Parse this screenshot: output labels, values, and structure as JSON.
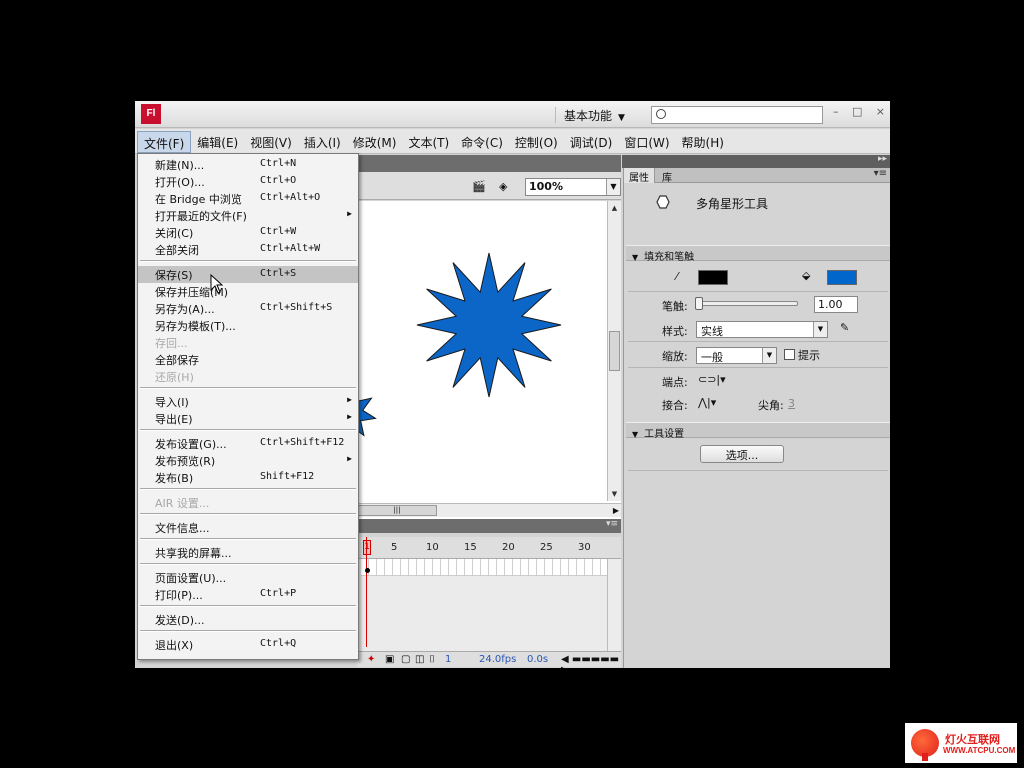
{
  "app": {
    "logo": "Fl",
    "workspace": "基本功能",
    "search_placeholder": "",
    "window_buttons": [
      "–",
      "□",
      "×"
    ]
  },
  "menubar": [
    "文件(F)",
    "编辑(E)",
    "视图(V)",
    "插入(I)",
    "修改(M)",
    "文本(T)",
    "命令(C)",
    "控制(O)",
    "调试(D)",
    "窗口(W)",
    "帮助(H)"
  ],
  "doc_toolbar": {
    "zoom": "100%"
  },
  "timeline": {
    "ticks": [
      "1",
      "5",
      "10",
      "15",
      "20",
      "25",
      "30"
    ],
    "current_frame": "1",
    "fps": "24.0fps",
    "time": "0.0s"
  },
  "properties": {
    "tabs": [
      "属性",
      "库"
    ],
    "tool_name": "多角星形工具",
    "fill_stroke_section": "填充和笔触",
    "stroke_color": "#000000",
    "fill_color": "#0066cc",
    "stroke_label": "笔触:",
    "stroke_value": "1.00",
    "stroke_fraction": 0.0,
    "style_label": "样式:",
    "style_value": "实线",
    "scale_label": "缩放:",
    "scale_value": "一般",
    "hint_label": "提示",
    "cap_label": "端点:",
    "join_label": "接合:",
    "miter_label": "尖角:",
    "miter_value": "3",
    "tool_settings_section": "工具设置",
    "options_button": "选项..."
  },
  "file_menu": {
    "items": [
      {
        "label": "新建(N)...",
        "shortcut": "Ctrl+N"
      },
      {
        "label": "打开(O)...",
        "shortcut": "Ctrl+O"
      },
      {
        "label": "在 Bridge 中浏览",
        "shortcut": "Ctrl+Alt+O"
      },
      {
        "label": "打开最近的文件(F)",
        "submenu": "▶"
      },
      {
        "label": "关闭(C)",
        "shortcut": "Ctrl+W"
      },
      {
        "label": "全部关闭",
        "shortcut": "Ctrl+Alt+W"
      },
      {
        "label": "保存(S)",
        "shortcut": "Ctrl+S"
      },
      {
        "label": "保存并压缩(M)"
      },
      {
        "label": "另存为(A)...",
        "shortcut": "Ctrl+Shift+S"
      },
      {
        "label": "另存为模板(T)..."
      },
      {
        "label": "存回..."
      },
      {
        "label": "全部保存"
      },
      {
        "label": "还原(H)"
      },
      {
        "label": "导入(I)",
        "submenu": "▶"
      },
      {
        "label": "导出(E)",
        "submenu": "▶"
      },
      {
        "label": "发布设置(G)...",
        "shortcut": "Ctrl+Shift+F12"
      },
      {
        "label": "发布预览(R)",
        "submenu": "▶"
      },
      {
        "label": "发布(B)",
        "shortcut": "Shift+F12"
      },
      {
        "label": "AIR 设置..."
      },
      {
        "label": "文件信息..."
      },
      {
        "label": "共享我的屏幕..."
      },
      {
        "label": "页面设置(U)..."
      },
      {
        "label": "打印(P)...",
        "shortcut": "Ctrl+P"
      },
      {
        "label": "发送(D)..."
      },
      {
        "label": "退出(X)",
        "shortcut": "Ctrl+Q"
      }
    ]
  },
  "watermark": {
    "name": "灯火互联网",
    "url": "WWW.ATCPU.COM"
  },
  "colors": {
    "star_fill": "#0b66c8",
    "menu_highlight": "#c4c4c4"
  }
}
